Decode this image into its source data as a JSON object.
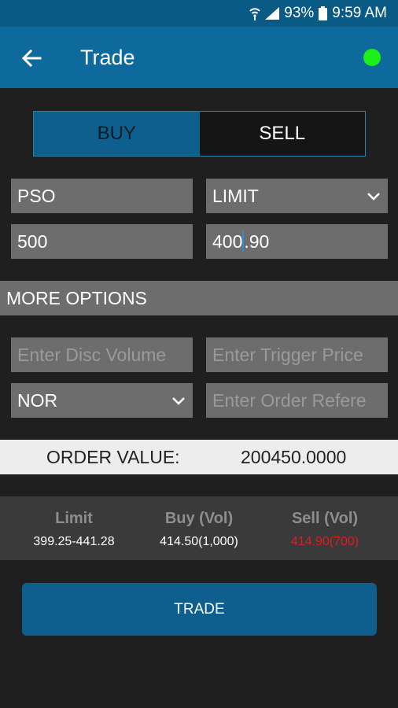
{
  "status_bar": {
    "battery": "93%",
    "time": "9:59 AM"
  },
  "app_bar": {
    "title": "Trade"
  },
  "toggle": {
    "buy": "BUY",
    "sell": "SELL",
    "selected": "BUY"
  },
  "form": {
    "symbol": "PSO",
    "order_type": "LIMIT",
    "volume": "500",
    "price_before_cursor": "400",
    "price_after_cursor": ".90",
    "disc_volume_placeholder": "Enter Disc Volume",
    "trigger_price_placeholder": "Enter Trigger Price",
    "validity": "NOR",
    "order_ref_placeholder": "Enter Order Refere"
  },
  "more_options_label": "MORE OPTIONS",
  "order_value": {
    "label": "ORDER VALUE:",
    "value": "200450.0000"
  },
  "market": {
    "limit_label": "Limit",
    "limit_value": "399.25-441.28",
    "buy_label": "Buy (Vol)",
    "buy_value": "414.50(1,000)",
    "sell_label": "Sell (Vol)",
    "sell_value": "414.90(700)"
  },
  "trade_button": "TRADE",
  "colors": {
    "app_bar": "#0e6a9c",
    "accent": "#0e5f8d",
    "status_online": "#1bf018",
    "sell_red": "#e01c1c"
  },
  "icons": [
    "wifi-icon",
    "signal-icon",
    "battery-icon",
    "back-arrow-icon",
    "chevron-down-icon"
  ]
}
